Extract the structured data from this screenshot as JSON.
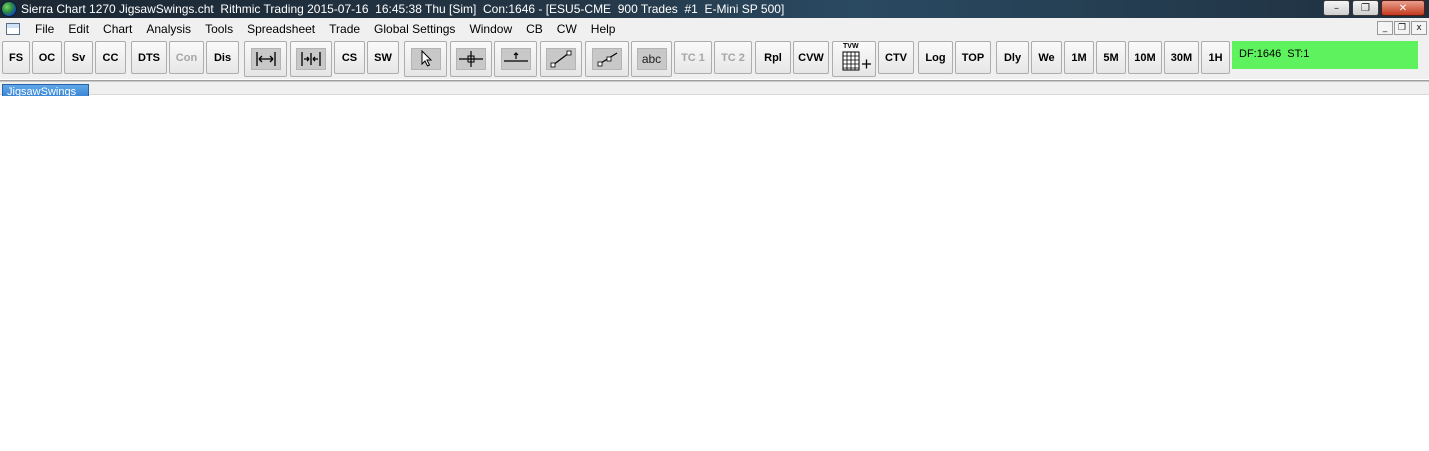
{
  "window": {
    "title": "Sierra Chart 1270 JigsawSwings.cht  Rithmic Trading 2015-07-16  16:45:38 Thu [Sim]  Con:1646 - [ESU5-CME  900 Trades  #1  E-Mini SP 500]",
    "minimize_glyph": "–",
    "maximize_glyph": "❐",
    "close_glyph": "✕"
  },
  "menu": {
    "items": [
      "File",
      "Edit",
      "Chart",
      "Analysis",
      "Tools",
      "Spreadsheet",
      "Trade",
      "Global Settings",
      "Window",
      "CB",
      "CW",
      "Help"
    ],
    "mdi_minimize": "_",
    "mdi_restore": "❐",
    "mdi_close": "x"
  },
  "toolbar": {
    "fs": "FS",
    "oc": "OC",
    "sv": "Sv",
    "cc": "CC",
    "dts": "DTS",
    "con": "Con",
    "dis": "Dis",
    "cs": "CS",
    "sw": "SW",
    "text_tool": "abc",
    "tc1": "TC 1",
    "tc2": "TC 2",
    "rpl": "Rpl",
    "cvw": "CVW",
    "tvw_label": "TVW",
    "ctv": "CTV",
    "log": "Log",
    "top": "TOP",
    "dly": "Dly",
    "we": "We",
    "m1": "1M",
    "m5": "5M",
    "m10": "10M",
    "m30": "30M",
    "h1": "1H"
  },
  "status": {
    "text": "DF:1646  ST:1",
    "color": "#5ef25e"
  },
  "tabs": {
    "active": "JigsawSwings"
  },
  "icons": {
    "app": "sierra-chart-globe-icon",
    "document": "chart-document-icon"
  }
}
